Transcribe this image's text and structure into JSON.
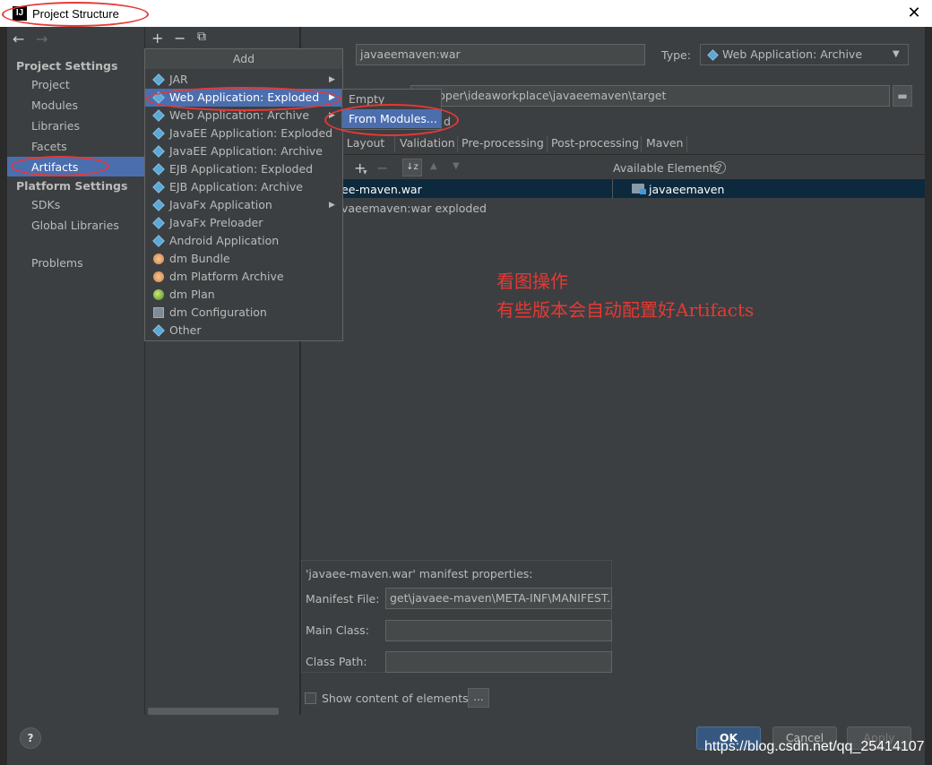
{
  "window": {
    "title": "Project Structure",
    "logo": "IJ",
    "close_glyph": "✕"
  },
  "sidebar": {
    "back": "←",
    "forward": "→",
    "section1": "Project Settings",
    "items1": [
      "Project",
      "Modules",
      "Libraries",
      "Facets",
      "Artifacts"
    ],
    "section2": "Platform Settings",
    "items2": [
      "SDKs",
      "Global Libraries"
    ],
    "problems": "Problems",
    "selected": "Artifacts"
  },
  "middle": {
    "add": "+",
    "remove": "−",
    "copy": "⧉"
  },
  "popup": {
    "header": "Add",
    "items": [
      {
        "label": "JAR",
        "icon": "diamond-icon",
        "submenu": true
      },
      {
        "label": "Web Application: Exploded",
        "icon": "diamond-icon",
        "submenu": true,
        "selected": true
      },
      {
        "label": "Web Application: Archive",
        "icon": "diamond-icon",
        "submenu": true
      },
      {
        "label": "JavaEE Application: Exploded",
        "icon": "diamond-icon",
        "submenu": false
      },
      {
        "label": "JavaEE Application: Archive",
        "icon": "diamond-icon",
        "submenu": false
      },
      {
        "label": "EJB Application: Exploded",
        "icon": "diamond-icon",
        "submenu": false
      },
      {
        "label": "EJB Application: Archive",
        "icon": "diamond-icon",
        "submenu": false
      },
      {
        "label": "JavaFx Application",
        "icon": "diamond-icon",
        "submenu": true
      },
      {
        "label": "JavaFx Preloader",
        "icon": "diamond-icon",
        "submenu": false
      },
      {
        "label": "Android Application",
        "icon": "diamond-icon",
        "submenu": false
      },
      {
        "label": "dm Bundle",
        "icon": "bundle-icon",
        "submenu": false
      },
      {
        "label": "dm Platform Archive",
        "icon": "platform-archive-icon",
        "submenu": false
      },
      {
        "label": "dm Plan",
        "icon": "plan-icon",
        "submenu": false
      },
      {
        "label": "dm Configuration",
        "icon": "config-icon",
        "submenu": false
      },
      {
        "label": "Other",
        "icon": "diamond-icon",
        "submenu": false
      }
    ],
    "submenu": [
      "Empty",
      "From Modules..."
    ]
  },
  "right": {
    "name_value": "javaeemaven:war",
    "type_label": "Type:",
    "type_value": "Web Application: Archive",
    "output_dir": "eveloper\\ideaworkplace\\javaeemaven\\target",
    "include_suffix": "d",
    "tabs": [
      "ut Layout",
      "Validation",
      "Pre-processing",
      "Post-processing",
      "Maven"
    ],
    "available_elements": "Available Elements",
    "tree_row1": "ee-maven.war",
    "tree_row2": "vaeemaven:war exploded",
    "available_item": "javaeemaven",
    "annotation_line1": "看图操作",
    "annotation_line2": "有些版本会自动配置好Artifacts",
    "manifest_title": "'javaee-maven.war' manifest properties:",
    "manifest_file_label": "Manifest File:",
    "manifest_file_value": "get\\javaee-maven\\META-INF\\MANIFEST.M",
    "main_class_label": "Main Class:",
    "class_path_label": "Class Path:",
    "show_content_label": "Show content of elements",
    "dots": "..."
  },
  "buttons": {
    "help": "?",
    "ok": "OK",
    "cancel": "Cancel",
    "apply": "Apply"
  },
  "watermark": "https://blog.csdn.net/qq_25414107",
  "colors": {
    "selection": "#4b6eaf",
    "annotation": "#e53935",
    "background": "#3c3f41"
  }
}
